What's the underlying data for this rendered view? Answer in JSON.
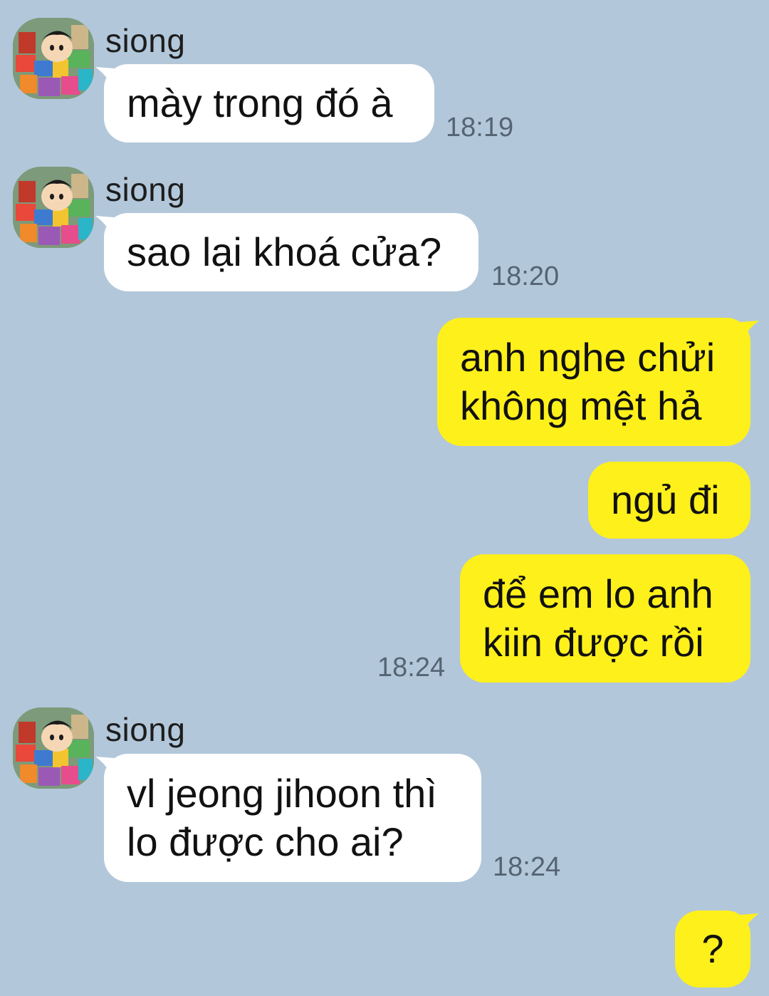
{
  "chat": {
    "colors": {
      "background": "#b2c7da",
      "incoming_bubble": "#ffffff",
      "outgoing_bubble": "#fef01b",
      "timestamp": "#556473"
    },
    "messages": [
      {
        "direction": "incoming",
        "sender": "siong",
        "avatar": "avatar-icon",
        "lines": [
          "mày trong đó à"
        ],
        "time": "18:19"
      },
      {
        "direction": "incoming",
        "sender": "siong",
        "avatar": "avatar-icon",
        "lines": [
          "sao lại khoá cửa?"
        ],
        "time": "18:20"
      },
      {
        "direction": "outgoing",
        "lines": [
          "anh nghe chửi",
          "không mệt hả"
        ]
      },
      {
        "direction": "outgoing",
        "lines": [
          "ngủ đi"
        ]
      },
      {
        "direction": "outgoing",
        "lines": [
          "để em lo anh",
          "kiin được rồi"
        ],
        "time": "18:24"
      },
      {
        "direction": "incoming",
        "sender": "siong",
        "avatar": "avatar-icon",
        "lines": [
          "vl jeong jihoon thì",
          "lo được cho ai?"
        ],
        "time": "18:24"
      },
      {
        "direction": "outgoing",
        "lines": [
          "?"
        ]
      }
    ]
  }
}
